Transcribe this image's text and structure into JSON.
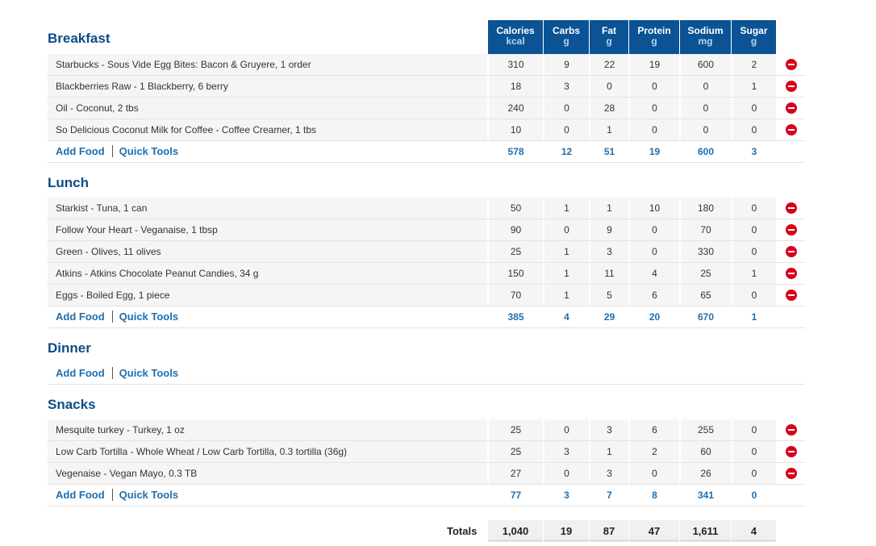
{
  "columns": [
    {
      "label": "Calories",
      "unit": "kcal"
    },
    {
      "label": "Carbs",
      "unit": "g"
    },
    {
      "label": "Fat",
      "unit": "g"
    },
    {
      "label": "Protein",
      "unit": "g"
    },
    {
      "label": "Sodium",
      "unit": "mg"
    },
    {
      "label": "Sugar",
      "unit": "g"
    }
  ],
  "links": {
    "add_food": "Add Food",
    "quick_tools": "Quick Tools"
  },
  "meals": [
    {
      "title": "Breakfast",
      "items": [
        {
          "name": "Starbucks - Sous Vide Egg Bites: Bacon & Gruyere, 1 order",
          "values": [
            "310",
            "9",
            "22",
            "19",
            "600",
            "2"
          ]
        },
        {
          "name": "Blackberries Raw - 1 Blackberry, 6 berry",
          "values": [
            "18",
            "3",
            "0",
            "0",
            "0",
            "1"
          ]
        },
        {
          "name": "Oil - Coconut, 2 tbs",
          "values": [
            "240",
            "0",
            "28",
            "0",
            "0",
            "0"
          ]
        },
        {
          "name": "So Delicious Coconut Milk for Coffee - Coffee Creamer, 1 tbs",
          "values": [
            "10",
            "0",
            "1",
            "0",
            "0",
            "0"
          ]
        }
      ],
      "totals": [
        "578",
        "12",
        "51",
        "19",
        "600",
        "3"
      ]
    },
    {
      "title": "Lunch",
      "items": [
        {
          "name": "Starkist - Tuna, 1 can",
          "values": [
            "50",
            "1",
            "1",
            "10",
            "180",
            "0"
          ]
        },
        {
          "name": "Follow Your Heart - Veganaise, 1 tbsp",
          "values": [
            "90",
            "0",
            "9",
            "0",
            "70",
            "0"
          ]
        },
        {
          "name": "Green - Olives, 11 olives",
          "values": [
            "25",
            "1",
            "3",
            "0",
            "330",
            "0"
          ]
        },
        {
          "name": "Atkins - Atkins Chocolate Peanut Candies, 34 g",
          "values": [
            "150",
            "1",
            "11",
            "4",
            "25",
            "1"
          ]
        },
        {
          "name": "Eggs - Boiled Egg, 1 piece",
          "values": [
            "70",
            "1",
            "5",
            "6",
            "65",
            "0"
          ]
        }
      ],
      "totals": [
        "385",
        "4",
        "29",
        "20",
        "670",
        "1"
      ]
    },
    {
      "title": "Dinner",
      "items": [],
      "totals": [
        "",
        "",
        "",
        "",
        "",
        ""
      ]
    },
    {
      "title": "Snacks",
      "items": [
        {
          "name": "Mesquite turkey - Turkey, 1 oz",
          "values": [
            "25",
            "0",
            "3",
            "6",
            "255",
            "0"
          ]
        },
        {
          "name": "Low Carb Tortilla - Whole Wheat / Low Carb Tortilla, 0.3 tortilla (36g)",
          "values": [
            "25",
            "3",
            "1",
            "2",
            "60",
            "0"
          ]
        },
        {
          "name": "Vegenaise - Vegan Mayo, 0.3 TB",
          "values": [
            "27",
            "0",
            "3",
            "0",
            "26",
            "0"
          ]
        }
      ],
      "totals": [
        "77",
        "3",
        "7",
        "8",
        "341",
        "0"
      ]
    }
  ],
  "grand_totals": {
    "label": "Totals",
    "values": [
      "1,040",
      "19",
      "87",
      "47",
      "1,611",
      "4"
    ]
  },
  "colors": {
    "header_bg": "#0b5394",
    "link": "#1f6fae",
    "remove": "#d9001b",
    "title": "#0b4e86"
  },
  "icons": {
    "remove": "minus-circle-icon"
  }
}
